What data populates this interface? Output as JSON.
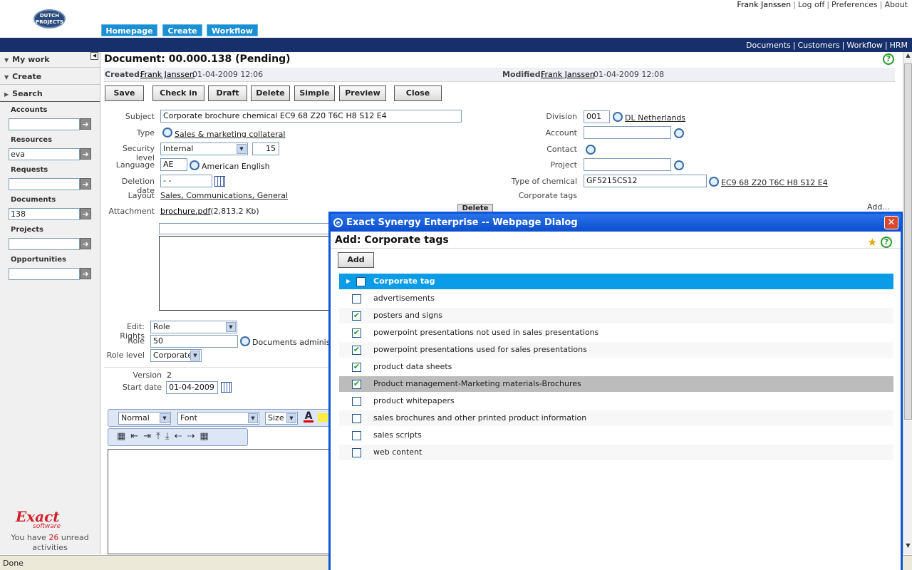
{
  "header": {
    "logo_text": "DUTCH PROJECTS",
    "user": "Frank Janssen",
    "links": [
      "Log off",
      "Preferences",
      "About"
    ],
    "tabs": [
      "Homepage",
      "Create",
      "Workflow"
    ],
    "sub_links": [
      "Documents",
      "Customers",
      "Workflow",
      "HRM"
    ]
  },
  "sidebar": {
    "sections": [
      "My work",
      "Create",
      "Search"
    ],
    "fields": [
      {
        "label": "Accounts",
        "value": ""
      },
      {
        "label": "Resources",
        "value": "eva"
      },
      {
        "label": "Requests",
        "value": ""
      },
      {
        "label": "Documents",
        "value": "138"
      },
      {
        "label": "Projects",
        "value": ""
      },
      {
        "label": "Opportunities",
        "value": ""
      }
    ],
    "brand": "Exact",
    "brand_sub": "software",
    "unread_pre": "You have",
    "unread_count": "26",
    "unread_post": "unread activities"
  },
  "doc": {
    "title": "Document: 00.000.138 (Pending)",
    "created_label": "Created:",
    "created_by": "Frank Janssen",
    "created_date": "01-04-2009 12:06",
    "modified_label": "Modified:",
    "modified_by": "Frank Janssen",
    "modified_date": "01-04-2009 12:08",
    "buttons": [
      "Save",
      "Check in",
      "Draft",
      "Delete",
      "Simple",
      "Preview",
      "Close"
    ]
  },
  "form": {
    "subject_label": "Subject",
    "subject": "Corporate brochure chemical EC9 68 Z20 T6C H8 S12 E4",
    "type_label": "Type",
    "type": "Sales & marketing collateral",
    "security_label": "Security level",
    "security": "Internal",
    "security_num": "15",
    "language_label": "Language",
    "language_code": "AE",
    "language": "American English",
    "deletion_label": "Deletion date",
    "deletion": "- -",
    "layout_label": "Layout",
    "layout": "Sales, Communications, General",
    "attachment_label": "Attachment",
    "attachment": "brochure.pdf",
    "attachment_size": "(2,813.2 Kb)",
    "delete_btn": "Delete",
    "division_label": "Division",
    "division_code": "001",
    "division": "DL Netherlands",
    "account_label": "Account",
    "contact_label": "Contact",
    "project_label": "Project",
    "chemical_label": "Type of chemical",
    "chemical_code": "GF5215CS12",
    "chemical": "EC9 68 Z20 T6C H8 S12 E4",
    "tags_label": "Corporate tags",
    "add_link": "Add...",
    "rights_label": "Edit: Rights",
    "rights": "Role",
    "role_label": "Role",
    "role": "50",
    "role_name": "Documents administrator",
    "rolelevel_label": "Role level",
    "rolelevel": "Corporate",
    "version_label": "Version",
    "version": "2",
    "start_label": "Start date",
    "start": "01-04-2009",
    "editor_style": "Normal",
    "editor_font": "Font",
    "editor_size": "Size"
  },
  "dialog": {
    "title": "Exact Synergy Enterprise -- Webpage Dialog",
    "heading": "Add: Corporate tags",
    "add_button": "Add",
    "header_row": "Corporate tag",
    "items": [
      {
        "label": "advertisements",
        "checked": false
      },
      {
        "label": "posters and signs",
        "checked": true
      },
      {
        "label": "powerpoint presentations not used in sales presentations",
        "checked": true
      },
      {
        "label": "powerpoint presentations used for sales presentations",
        "checked": true
      },
      {
        "label": "product data sheets",
        "checked": true
      },
      {
        "label": "Product management-Marketing materials-Brochures",
        "checked": true
      },
      {
        "label": "product whitepapers",
        "checked": false
      },
      {
        "label": "sales brochures and other printed product information",
        "checked": false
      },
      {
        "label": "sales scripts",
        "checked": false
      },
      {
        "label": "web content",
        "checked": false
      }
    ]
  },
  "status": "Done"
}
